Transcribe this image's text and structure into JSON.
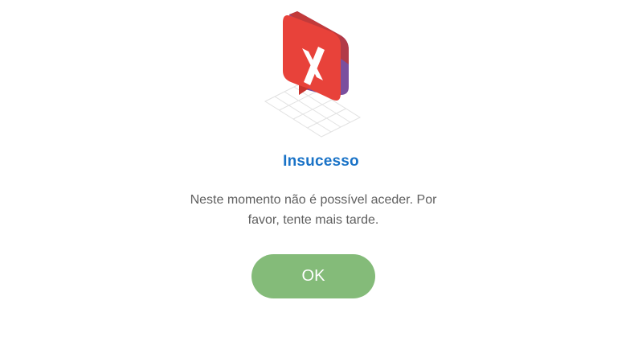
{
  "dialog": {
    "icon": "error-x-speech-bubble-icon",
    "title": "Insucesso",
    "message": "Neste momento não é possível aceder. Por favor, tente mais tarde.",
    "ok_label": "OK"
  },
  "colors": {
    "title": "#1a73c7",
    "message": "#5f5f5f",
    "button": "#84bb79",
    "icon_red": "#e8423a",
    "icon_purple": "#7a4f9e"
  }
}
